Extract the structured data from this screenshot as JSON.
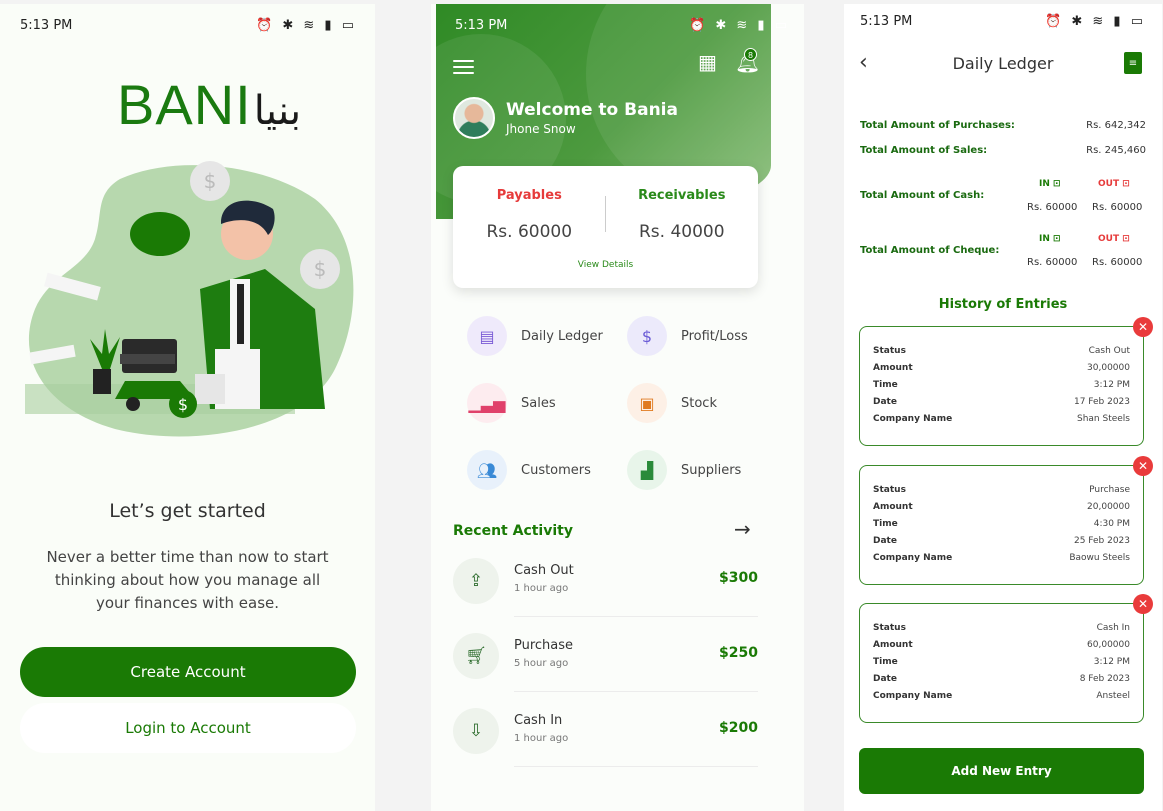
{
  "screen1": {
    "status_time": "5:13 PM",
    "status_icons": "⏰ ✱ ≋ ▮ ▭",
    "logo_text": "BANI",
    "logo_arabic": "بنیا",
    "heading": "Let’s get started",
    "subtext": "Never a better time than now to start thinking about how you manage all your finances with ease.",
    "create_button": "Create Account",
    "login_button": "Login to Account"
  },
  "screen2": {
    "status_time": "5:13 PM",
    "status_icons": "⏰ ✱ ≋ ▮ ▭",
    "notification_count": "8",
    "welcome": "Welcome to Bania",
    "username": "Jhone Snow",
    "payables_label": "Payables",
    "payables_value": "Rs. 60000",
    "receivables_label": "Receivables",
    "receivables_value": "Rs. 40000",
    "view_details": "View Details",
    "grid": [
      {
        "label": "Daily Ledger",
        "icon": "ledger-icon",
        "color": "#7a5bd6",
        "bg": "#efeafb"
      },
      {
        "label": "Profit/Loss",
        "icon": "profit-loss-icon",
        "color": "#6a5bd6",
        "bg": "#eceafb"
      },
      {
        "label": "Sales",
        "icon": "sales-icon",
        "color": "#e0406a",
        "bg": "#fdecef"
      },
      {
        "label": "Stock",
        "icon": "stock-icon",
        "color": "#e07a20",
        "bg": "#fdf0e6"
      },
      {
        "label": "Customers",
        "icon": "customers-icon",
        "color": "#3a8ad6",
        "bg": "#e8f1fb"
      },
      {
        "label": "Suppliers",
        "icon": "suppliers-icon",
        "color": "#2a8a3a",
        "bg": "#e8f5ea"
      }
    ],
    "recent_title": "Recent Activity",
    "activities": [
      {
        "name": "Cash Out",
        "time": "1 hour ago",
        "amount": "$300",
        "icon": "cash-out-icon"
      },
      {
        "name": "Purchase",
        "time": "5 hour ago",
        "amount": "$250",
        "icon": "cart-icon"
      },
      {
        "name": "Cash In",
        "time": "1 hour ago",
        "amount": "$200",
        "icon": "cash-in-icon"
      }
    ]
  },
  "screen3": {
    "status_time": "5:13 PM",
    "status_icons": "⏰ ✱ ≋ ▮ ▭",
    "title": "Daily Ledger",
    "total_purchases_label": "Total Amount of Purchases:",
    "total_purchases_value": "Rs. 642,342",
    "total_sales_label": "Total Amount  of Sales:",
    "total_sales_value": "Rs. 245,460",
    "cash_label": "Total Amount  of Cash:",
    "cheque_label": "Total Amount  of Cheque:",
    "in_label": "IN",
    "out_label": "OUT",
    "cash_in": "Rs. 60000",
    "cash_out": "Rs. 60000",
    "cheque_in": "Rs. 60000",
    "cheque_out": "Rs. 60000",
    "history_title": "History of Entries",
    "field_labels": [
      "Status",
      "Amount",
      "Time",
      "Date",
      "Company Name"
    ],
    "entries": [
      {
        "status": "Cash Out",
        "amount": "30,00000",
        "time": "3:12 PM",
        "date": "17 Feb 2023",
        "company": "Shan Steels"
      },
      {
        "status": "Purchase",
        "amount": "20,00000",
        "time": "4:30 PM",
        "date": "25 Feb 2023",
        "company": "Baowu Steels"
      },
      {
        "status": "Cash In",
        "amount": "60,00000",
        "time": "3:12 PM",
        "date": "8 Feb 2023",
        "company": "Ansteel"
      }
    ],
    "add_button": "Add New Entry"
  },
  "colors": {
    "brand_green": "#1a7a05",
    "payables_red": "#e63b3b",
    "delete_red": "#e93b3b"
  }
}
